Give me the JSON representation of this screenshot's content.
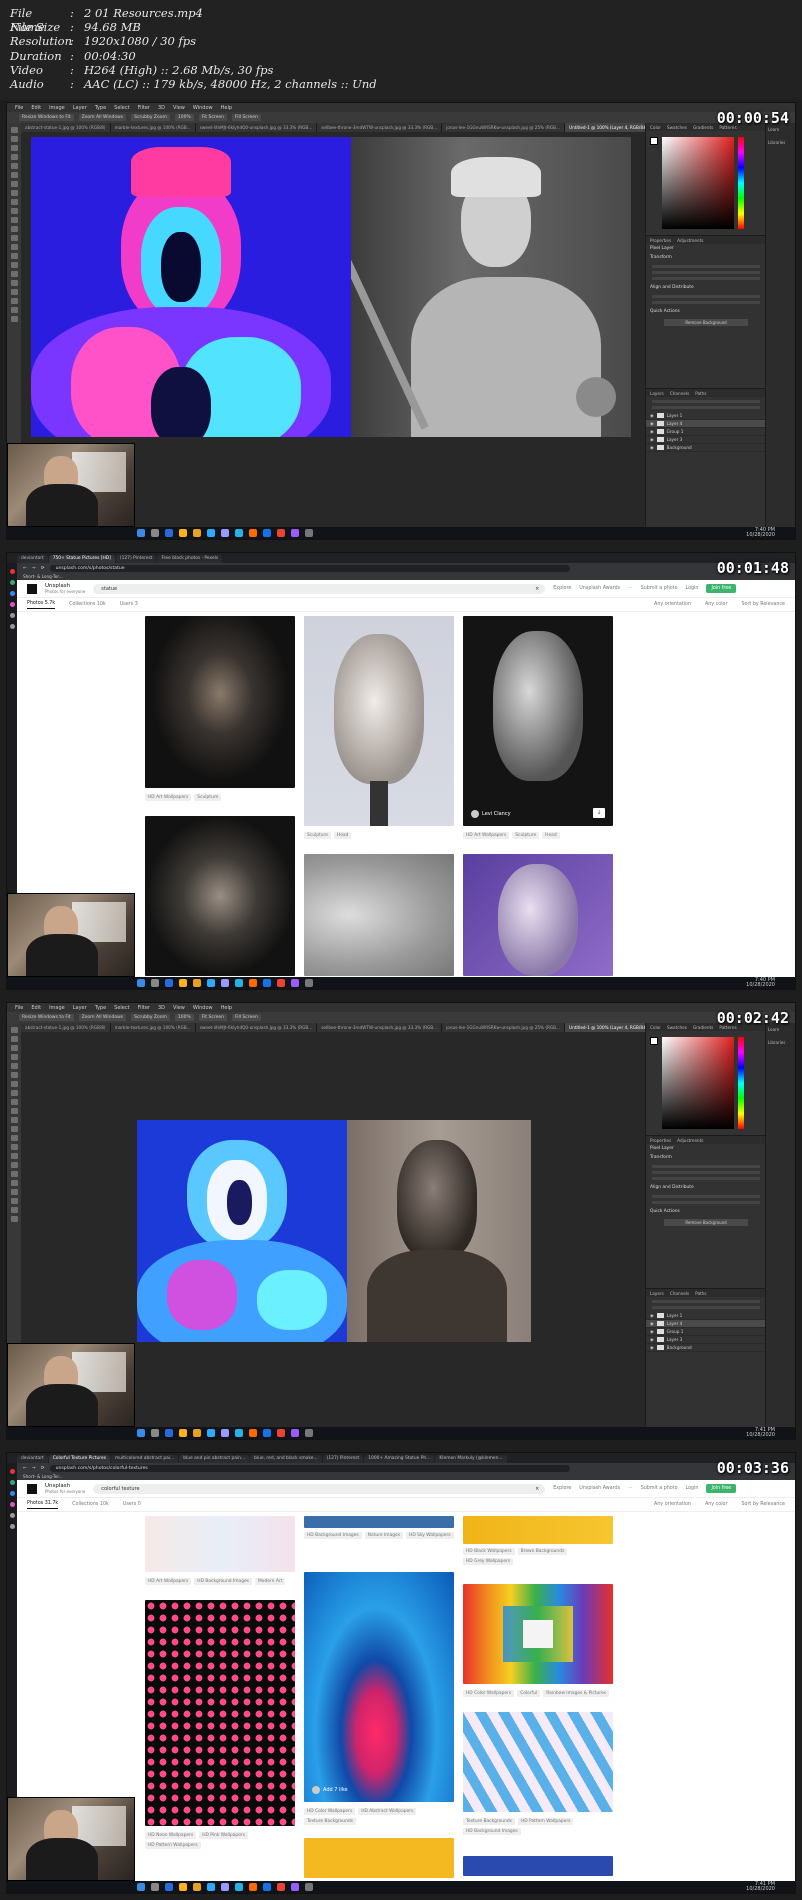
{
  "info": {
    "rows": [
      {
        "key": "File Name",
        "value": "2 01 Resources.mp4"
      },
      {
        "key": "File Size",
        "value": "94.68 MB"
      },
      {
        "key": "Resolution",
        "value": "1920x1080 / 30 fps"
      },
      {
        "key": "Duration",
        "value": "00:04:30"
      },
      {
        "key": "Video",
        "value": "H264 (High) :: 2.68 Mb/s, 30 fps"
      },
      {
        "key": "Audio",
        "value": "AAC (LC) :: 179 kb/s, 48000 Hz, 2 channels :: Und"
      }
    ]
  },
  "frames": [
    {
      "timestamp": "00:00:54"
    },
    {
      "timestamp": "00:01:48"
    },
    {
      "timestamp": "00:02:42"
    },
    {
      "timestamp": "00:03:36"
    }
  ],
  "photoshop": {
    "menu": [
      "File",
      "Edit",
      "Image",
      "Layer",
      "Type",
      "Select",
      "Filter",
      "3D",
      "View",
      "Window",
      "Help"
    ],
    "options": [
      "Resize Windows to Fit",
      "Zoom All Windows",
      "Scrubby Zoom",
      "100%",
      "Fit Screen",
      "Fill Screen"
    ],
    "tabs_a": [
      "abstract-statue-1.jpg @ 100% (RGB/8)",
      "marble-textures.jpg @ 100% (RGB...",
      "sweet-lifeMJt-6klyhdQ0-unsplash.jpg @ 33.3% (RGB...",
      "sellbee-throne-3mdWTW-unsplash.jpg @ 33.3% (RGB...",
      "jonas-lee-1GGnuWRSRKw-unsplash.jpg @ 25% (RGB...",
      "Untitled-1 @ 100% (Layer 4, RGB/8#)"
    ],
    "tabs_b": [
      "abstract-statue-1.jpg @ 100% (RGB/8)",
      "marble-textures.jpg @ 100% (RGB...",
      "sweet-lifeMJt-6klyhdQ0-unsplash.jpg @ 33.3% (RGB...",
      "sellbee-throne-3mdWTW-unsplash.jpg @ 33.3% (RGB...",
      "jonas-lee-1GGnuWRSRKw-unsplash.jpg @ 25% (RGB...",
      "Untitled-1 @ 100% (Layer 4, RGB/8#)"
    ],
    "panel_tabs": [
      "Color",
      "Swatches",
      "Gradients",
      "Patterns"
    ],
    "side_items": [
      "Learn",
      "Libraries"
    ],
    "props_tabs": [
      "Properties",
      "Adjustments"
    ],
    "props_label": "Pixel Layer",
    "sections": [
      "Transform",
      "Align and Distribute",
      "Quick Actions"
    ],
    "remove_bg": "Remove Background",
    "layers_tabs": [
      "Layers",
      "Channels",
      "Paths"
    ],
    "layers": [
      "Layer 1",
      "Layer 4",
      "Group 1",
      "Layer 3",
      "Background"
    ]
  },
  "browser1": {
    "tabs": [
      "deviantart",
      "750+ Statue Pictures [HD]",
      "(127) Pinterest",
      "Free black photos · Pexels"
    ],
    "url": "unsplash.com/s/photos/statue",
    "bookmark": "Short- & Long-Ter...",
    "brand": "Unsplash",
    "tagline": "Photos for everyone",
    "query": "statue",
    "nav": [
      "Explore",
      "Unsplash Awards",
      "···",
      "Submit a photo",
      "Login"
    ],
    "join": "Join free",
    "sub": [
      "Photos 5.7k",
      "Collections 10k",
      "Users 3"
    ],
    "filters": [
      "Any orientation",
      "Any color",
      "Sort by Relevance"
    ],
    "tags": {
      "c1a": [
        "HD Art Wallpapers",
        "Sculpture"
      ],
      "c2a": [
        "Sculpture",
        "Head"
      ],
      "c3a": [
        "HD Art Wallpapers",
        "Sculpture",
        "Head"
      ]
    },
    "credit": "Levi Clancy"
  },
  "browser2": {
    "tabs": [
      "deviantart",
      "Colorful Texture Pictures",
      "multicolored abstract pai...",
      "blue and pin abstract pain...",
      "blue, red, and black smoke...",
      "(127) Pinterest",
      "1000+ Amazing Statue Ph...",
      "Klemen Markuly (@klemen..."
    ],
    "url": "unsplash.com/s/photos/colorful-textures",
    "bookmark": "Short- & Long-Ter...",
    "brand": "Unsplash",
    "tagline": "Photos for everyone",
    "query": "colorful texture",
    "nav": [
      "Explore",
      "Unsplash Awards",
      "···",
      "Submit a photo",
      "Login"
    ],
    "join": "Join free",
    "sub": [
      "Photos 31.7k",
      "Collections 10k",
      "Users 0"
    ],
    "filters": [
      "Any orientation",
      "Any color",
      "Sort by Relevance"
    ],
    "tags": {
      "c1a": [
        "HD Art Wallpapers",
        "HD Background Images",
        "Modern Art"
      ],
      "c1b": [
        "HD Neon Wallpapers",
        "HD Pink Wallpapers",
        "HD Pattern Wallpapers"
      ],
      "c2a": [
        "HD Background Images",
        "Nature Images",
        "HD Sky Wallpapers"
      ],
      "c2b": [
        "HD Color Wallpapers",
        "HD Abstract Wallpapers",
        "Texture Backgrounds"
      ],
      "c3a": [
        "HD Black Wallpapers",
        "Brown Backgrounds",
        "HD Grey Wallpapers"
      ],
      "c3b": [
        "HD Color Wallpapers",
        "Colorful",
        "Rainbow Images & Pictures"
      ],
      "c3c": [
        "Texture Backgrounds",
        "HD Pattern Wallpapers",
        "HD Background Images"
      ]
    },
    "credit": "Add 7 like"
  },
  "clock": {
    "time": "7:40 PM",
    "date": "10/28/2020"
  },
  "clock2": {
    "time": "7:41 PM",
    "date": "10/28/2020"
  }
}
